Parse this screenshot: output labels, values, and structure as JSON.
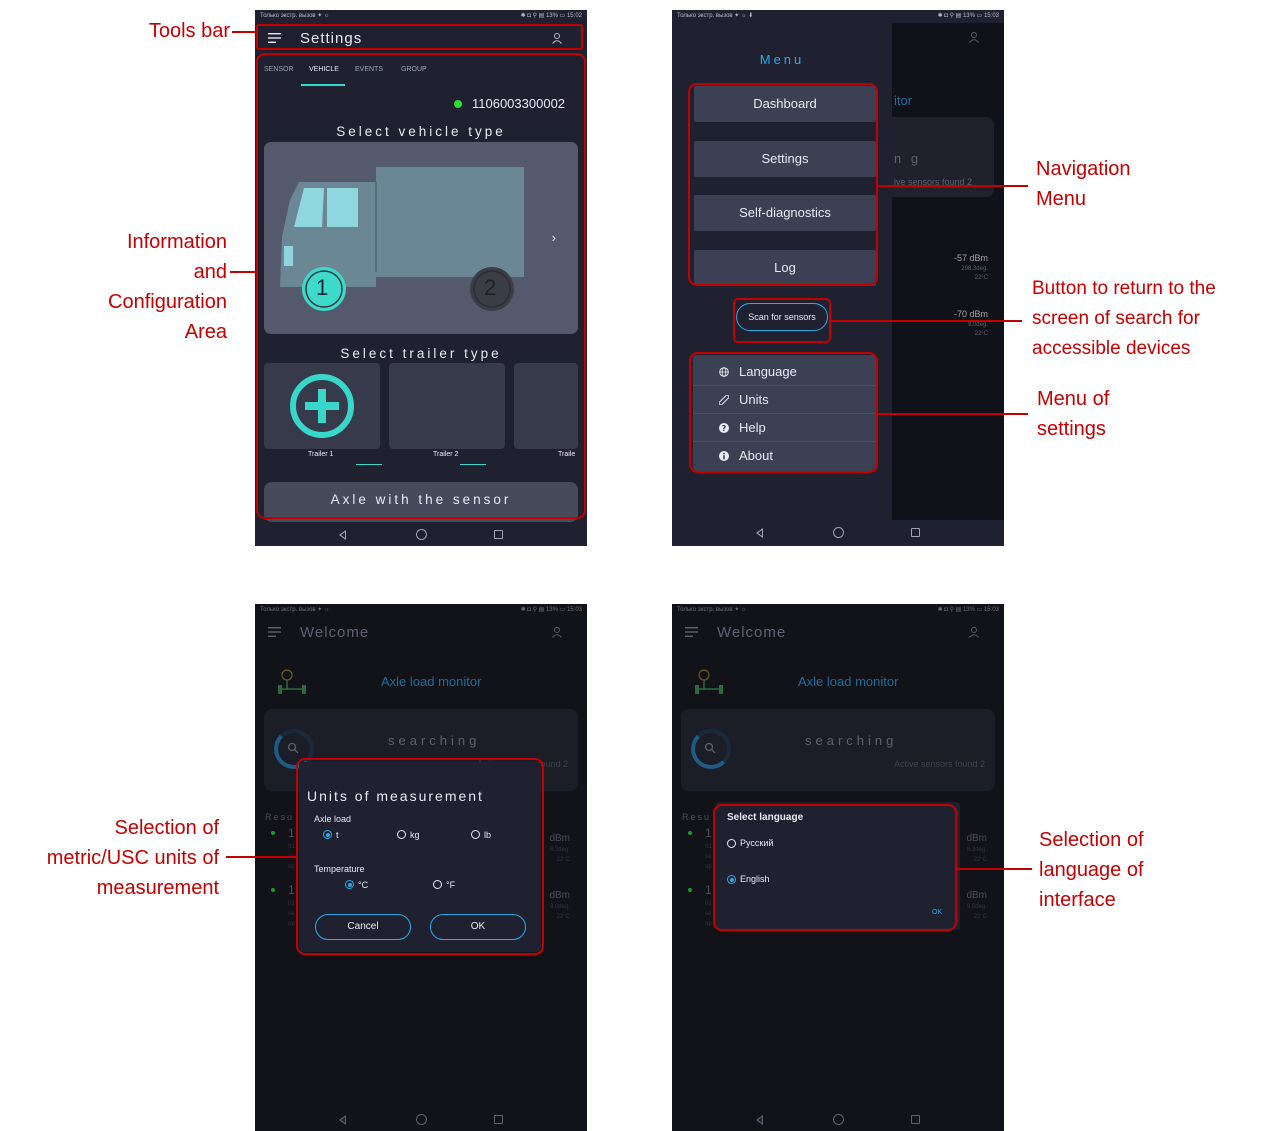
{
  "status": {
    "left": "Только экстр. вызов ✦ ☼",
    "left2": "Только экстр. вызов ✦ ☼ ⬇",
    "right1": "✱ ◘ ⚲ ▤ 13% ▭ 15:02",
    "right2": "✱ ◘ ⚲ ▤ 13% ▭ 15:03"
  },
  "screen1": {
    "title": "Settings",
    "tabs": [
      "SENSOR",
      "VEHICLE",
      "EVENTS",
      "GROUP"
    ],
    "device_id": "1106003300002",
    "select_vehicle": "Select vehicle type",
    "axle_1": "1",
    "axle_2": "2",
    "chevron": "›",
    "select_trailer": "Select trailer type",
    "trailers": [
      "Trailer 1",
      "Trailer 2",
      "Traile"
    ],
    "axle_sensor": "Axle with the sensor"
  },
  "screen2": {
    "menu_title": "Menu",
    "menu_items": [
      "Dashboard",
      "Settings",
      "Self-diagnostics",
      "Log"
    ],
    "scan_button": "Scan for sensors",
    "settings_items": [
      "Language",
      "Units",
      "Help",
      "About"
    ],
    "behind": {
      "itor": "itor",
      "ng": "n g",
      "sensors": "ive sensors found  2",
      "dbm1": "-57 dBm",
      "deg1": "298.3deg.",
      "temp1": "22°C",
      "dbm2": "-70 dBm",
      "deg2": "9.0deg.",
      "temp2": "22°C"
    }
  },
  "welcome": {
    "title": "Welcome",
    "app_name": "Axle load monitor",
    "searching": "searching",
    "active_sensors": "Active sensors found  2",
    "results": "Resu",
    "num": "1",
    "dbm": "dBm",
    "deg_a": "8.3deg.",
    "deg_b": "9.0deg.",
    "temp": "22°C",
    "small_a": "01",
    "small_b": "se",
    "small_c": "op"
  },
  "units_dialog": {
    "title": "Units of measurement",
    "axle_load_label": "Axle load",
    "axle_options": [
      "t",
      "kg",
      "lb"
    ],
    "temperature_label": "Temperature",
    "temp_options": [
      "°C",
      "°F"
    ],
    "cancel": "Cancel",
    "ok": "OK"
  },
  "language_dialog": {
    "title": "Select language",
    "options": [
      "Русский",
      "English"
    ],
    "ok": "OK"
  },
  "annotations": {
    "tools_bar": "Tools bar",
    "info_area_lines": [
      "Information",
      "and",
      "Configuration",
      "Area"
    ],
    "nav_menu_lines": [
      "Navigation",
      "Menu"
    ],
    "scan_lines": [
      "Button to return to the",
      "screen of search for",
      "accessible devices"
    ],
    "settings_menu_lines": [
      "Menu of",
      "settings"
    ],
    "units_lines": [
      "Selection of",
      "metric/USC units of",
      "measurement"
    ],
    "lang_lines": [
      "Selection of",
      "language of",
      "interface"
    ]
  },
  "colors": {
    "annotation": "#c40000",
    "accent": "#2aa9e6",
    "teal": "#39d6ca",
    "online": "#26e032"
  }
}
